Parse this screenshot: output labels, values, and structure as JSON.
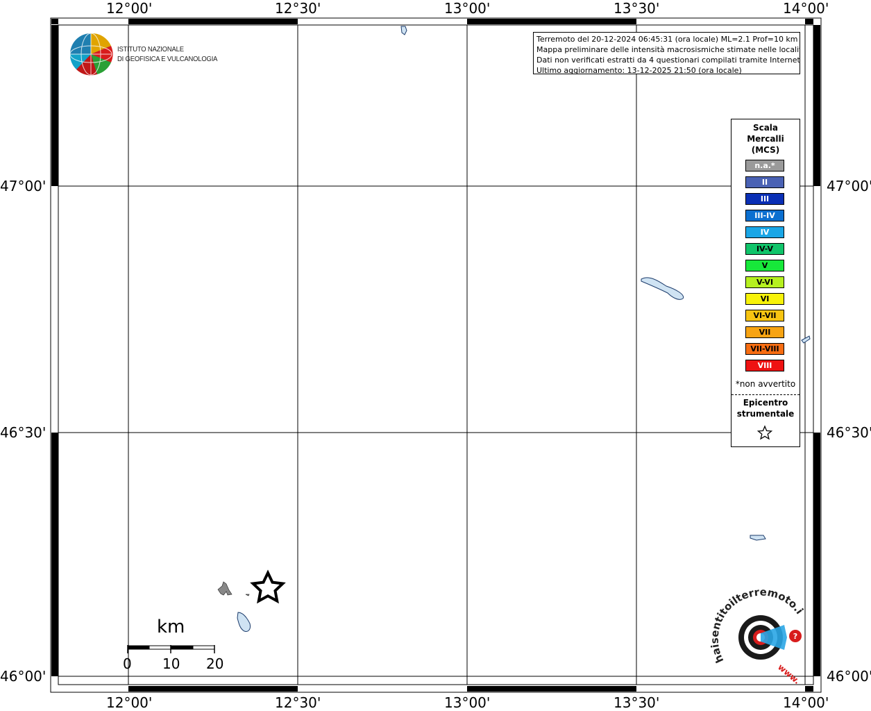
{
  "info": {
    "line1": "Terremoto del 20-12-2024 06:45:31 (ora locale) ML=2.1 Prof=10 km",
    "line2": "Mappa preliminare delle intensità macrosismiche stimate nelle località",
    "line3": "Dati non verificati estratti da 4 questionari compilati tramite Internet.",
    "line4": "Ultimo aggiornamento: 13-12-2025 21:50 (ora locale)"
  },
  "institute": {
    "line1": "ISTITUTO NAZIONALE",
    "line2": "DI GEOFISICA E VULCANOLOGIA"
  },
  "axes": {
    "lon_labels": [
      "12°00'",
      "12°30'",
      "13°00'",
      "13°30'",
      "14°00'"
    ],
    "lat_labels": [
      "47°00'",
      "46°30'",
      "46°00'"
    ]
  },
  "legend": {
    "title_1": "Scala",
    "title_2": "Mercalli",
    "title_3": "(MCS)",
    "items": [
      {
        "label": "n.a.*",
        "color": "#9a9a9a",
        "text_color": "#ffffff"
      },
      {
        "label": "II",
        "color": "#4a62b4",
        "text_color": "#ffffff"
      },
      {
        "label": "III",
        "color": "#0a2fb5",
        "text_color": "#ffffff"
      },
      {
        "label": "III-IV",
        "color": "#0b6fd0",
        "text_color": "#ffffff"
      },
      {
        "label": "IV",
        "color": "#1aa6e6",
        "text_color": "#ffffff"
      },
      {
        "label": "IV-V",
        "color": "#10c46a",
        "text_color": "#000000"
      },
      {
        "label": "V",
        "color": "#17e83a",
        "text_color": "#000000"
      },
      {
        "label": "V-VI",
        "color": "#b6f020",
        "text_color": "#000000"
      },
      {
        "label": "VI",
        "color": "#f7f20a",
        "text_color": "#000000"
      },
      {
        "label": "VI-VII",
        "color": "#f7c412",
        "text_color": "#000000"
      },
      {
        "label": "VII",
        "color": "#f7a312",
        "text_color": "#000000"
      },
      {
        "label": "VII-VIII",
        "color": "#f76d12",
        "text_color": "#000000"
      },
      {
        "label": "VIII",
        "color": "#ee1212",
        "text_color": "#ffffff"
      }
    ],
    "note": "*non avvertito",
    "epicenter_1": "Epicentro",
    "epicenter_2": "strumentale",
    "epicenter_icon": "star-icon"
  },
  "scale_bar": {
    "title": "km",
    "labels": [
      "0",
      "10",
      "20"
    ]
  },
  "brand": {
    "text": "haisentitoilterremoto.it",
    "prefix": "www."
  }
}
